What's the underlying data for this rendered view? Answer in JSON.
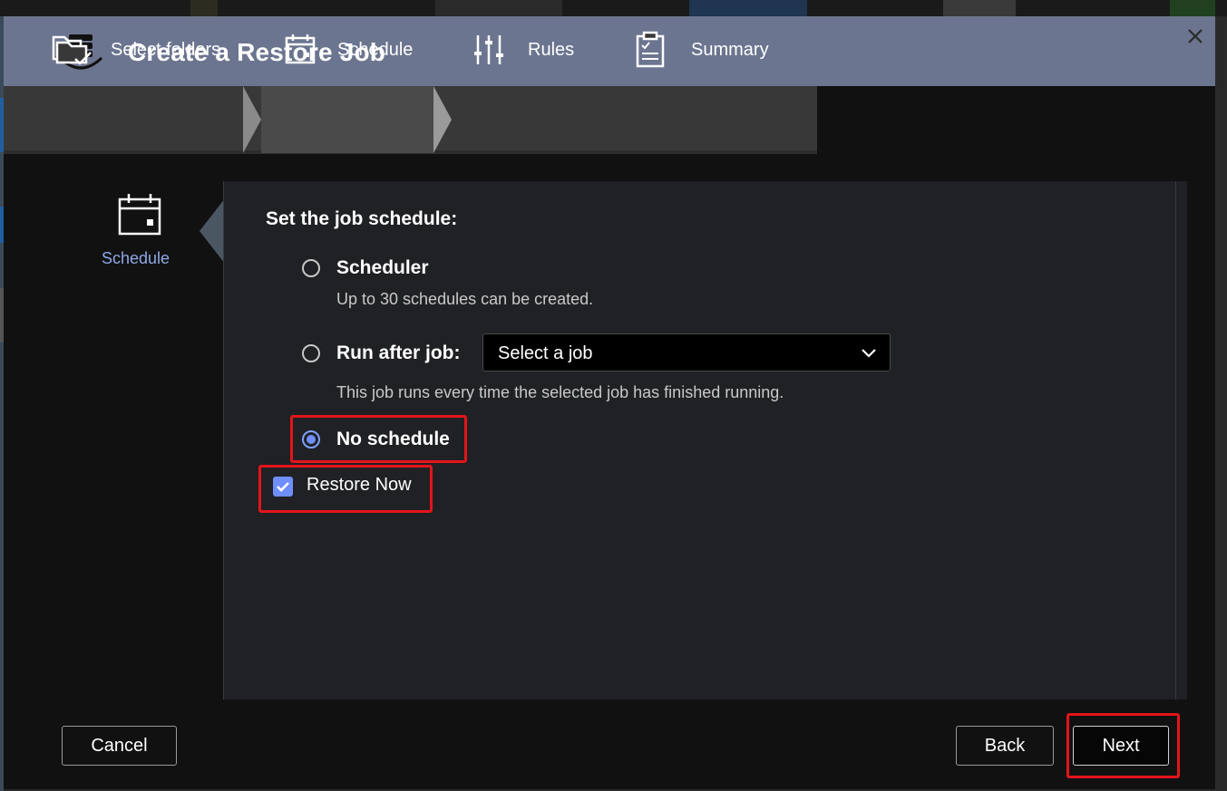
{
  "dialog": {
    "title": "Create a Restore Job",
    "title_icon": "backup-stack-icon",
    "close_icon": "close-icon"
  },
  "steps": [
    {
      "label": "Select folders",
      "icon": "folder-check-icon",
      "active": false
    },
    {
      "label": "Schedule",
      "icon": "calendar-icon",
      "active": true
    },
    {
      "label": "Rules",
      "icon": "sliders-icon",
      "active": false
    },
    {
      "label": "Summary",
      "icon": "clipboard-icon",
      "active": false
    }
  ],
  "sidebar": {
    "label": "Schedule",
    "icon": "calendar-icon"
  },
  "schedule": {
    "heading": "Set the job schedule:",
    "options": [
      {
        "label": "Scheduler",
        "description": "Up to 30 schedules can be created.",
        "selected": false
      },
      {
        "label": "Run after job:",
        "description": "This job runs every time the selected job has finished running.",
        "selected": false
      },
      {
        "label": "No schedule",
        "selected": true
      }
    ],
    "job_select": {
      "value": "Select a job",
      "icon": "chevron-down-icon"
    },
    "restore_now": {
      "label": "Restore Now",
      "checked": true
    }
  },
  "buttons": {
    "cancel": "Cancel",
    "back": "Back",
    "next": "Next"
  },
  "colors": {
    "accent": "#6f8fff",
    "title_bar": "#6c758f",
    "highlight": "#e4141b",
    "sidebar_label": "#8ea8e4"
  }
}
